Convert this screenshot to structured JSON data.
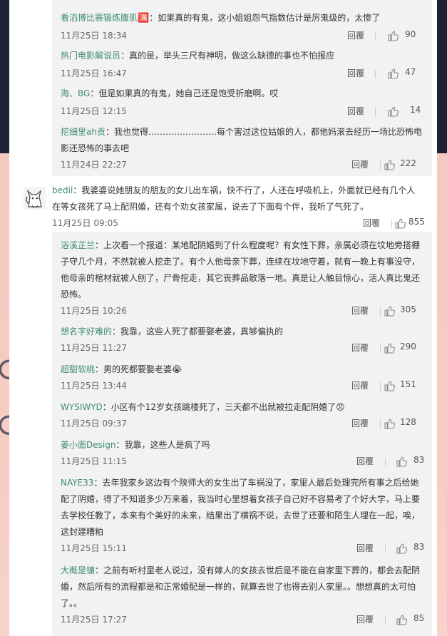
{
  "comments": [
    {
      "user": "看滔博比赛锻炼腹肌",
      "text": "：如果真的有鬼，这小姐姐怨气指数估计是厉鬼级的，太惨了",
      "time": "11月25日 18:34",
      "reply": "回覆",
      "likes": "90"
    },
    {
      "user": "热门电影解说员",
      "text": "：真的是，举头三尺有神明，做这么缺德的事也不怕报应",
      "time": "11月25日 16:47",
      "reply": "回覆",
      "likes": "47"
    },
    {
      "user": "海、BG",
      "text": "：但是如果真的有鬼，她自己还是饱受折磨啊。哎",
      "time": "11月25日 12:15",
      "reply": "回覆",
      "likes": "14"
    },
    {
      "user": "挖细里ah贡",
      "text": "：我也觉得……………………每个害过这位姑娘的人，都他妈滚去经历一场比恐怖电影还恐怖的事去吧",
      "time": "11月24日 22:27",
      "reply": "回覆",
      "likes": "222"
    }
  ],
  "main_comment": {
    "user": "bedil",
    "text": "：我婆婆说她朋友的朋友的女儿出车祸，快不行了，人还在呼吸机上，外面就已经有几个人在等女孩死了马上配阴婚，还有个劝女孩家属，说去了下面有个伴，我听了气死了。",
    "time": "11月25日 09:05",
    "reply": "回覆",
    "likes": "855"
  },
  "replies": [
    {
      "user": "浴溪芷兰",
      "text": "：上次看一个报道：某地配阴婚到了什么程度呢？有女性下葬，亲属必须在坟地旁搭棚子守几个月，不然就被人挖走了。有个人他母亲下葬，连续在坟地守着，就有一晚上有事没守，他母亲的棺材就被人刨了，尸骨挖走，其它丧葬品散落一地。真是让人触目惊心，活人真比鬼还恐怖。",
      "time": "11月25日 10:26",
      "reply": "回覆",
      "likes": "305"
    },
    {
      "user": "想名字好难的",
      "text": "：我靠，这些人死了都要娶老婆，真够偏执的",
      "time": "11月25日 11:27",
      "reply": "回覆",
      "likes": "290"
    },
    {
      "user": "超甜软桃",
      "text": "：男的死都要娶老婆",
      "time": "11月25日 13:44",
      "reply": "回覆",
      "likes": "151",
      "emoji": "😭"
    },
    {
      "user": "WYSIWYD",
      "text": "：小区有个12岁女孩跳楼死了，三天都不出就被拉走配阴婚了",
      "time": "11月25日 09:37",
      "reply": "回覆",
      "likes": "128",
      "emoji": "😠"
    },
    {
      "user": "姜小面Design",
      "text": "：我靠，这些人是疯了吗",
      "time": "11月25日 11:15",
      "reply": "回覆",
      "likes": "83"
    },
    {
      "user": "NAYE33",
      "text": "：去年我家乡这边有个陕师大的女生出了车祸没了，家里人最后处理完所有事之后给她配了阴婚，得了不知道多少万来着，我当时心里想着女孩子自己好不容易考了个好大学，马上要去学校任教了，本来有个美好的未来，结果出了横祸不说，去世了还要和陌生人埋在一起，唉，这封建糟粕",
      "time": "11月25日 15:11",
      "reply": "回覆",
      "likes": "83"
    },
    {
      "user": "大概是镰",
      "text": "：之前有听村里老人说过，没有嫁人的女孩去世后是不能在自家里下葬的，都会去配阴婚，然后所有的流程都是和正常婚配是一样的，就算去世了也得去别人家里。。想想真的太可怕了。。",
      "time": "11月25日 17:27",
      "reply": "回覆",
      "likes": "85"
    }
  ],
  "badge_emoji": "🈵",
  "colors": {
    "username": "#3f8c6e",
    "thread_bg": "#f2f2f5",
    "text": "#333333"
  }
}
